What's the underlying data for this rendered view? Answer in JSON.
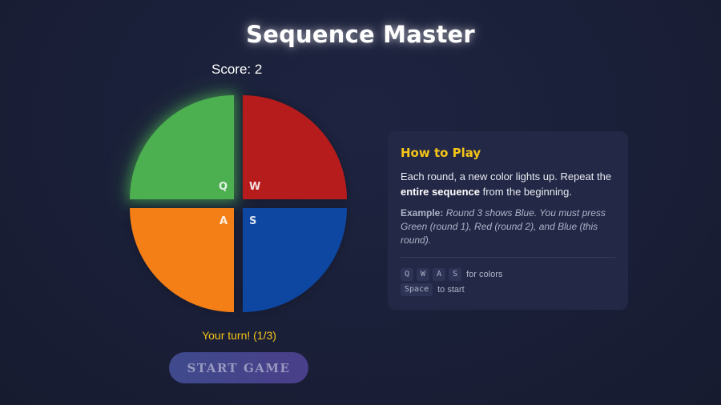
{
  "title": "Sequence Master",
  "score": {
    "text": "Score: 2"
  },
  "board": {
    "pads": [
      {
        "color_name": "green",
        "color": "#4caf50",
        "key": "Q",
        "lit": true
      },
      {
        "color_name": "red",
        "color": "#b71c1c",
        "key": "W",
        "lit": false
      },
      {
        "color_name": "orange",
        "color": "#f57f17",
        "key": "A",
        "lit": false
      },
      {
        "color_name": "blue",
        "color": "#0d47a1",
        "key": "S",
        "lit": false
      }
    ]
  },
  "status": "Your turn! (1/3)",
  "start_button": {
    "label": "START GAME",
    "enabled": false
  },
  "how_to_play": {
    "title": "How to Play",
    "desc_pre": "Each round, a new color lights up. Repeat the ",
    "desc_bold": "entire sequence",
    "desc_post": " from the beginning.",
    "example_label": "Example:",
    "example_text": " Round 3 shows Blue. You must press Green (round 1), Red (round 2), and Blue (this round).",
    "controls": [
      {
        "keys": [
          "Q",
          "W",
          "A",
          "S"
        ],
        "text": "for colors"
      },
      {
        "keys": [
          "Space"
        ],
        "text": "to start"
      }
    ]
  },
  "colors": {
    "accent_yellow": "#f5c518",
    "background": "#1a1f38",
    "panel": "#232846"
  }
}
